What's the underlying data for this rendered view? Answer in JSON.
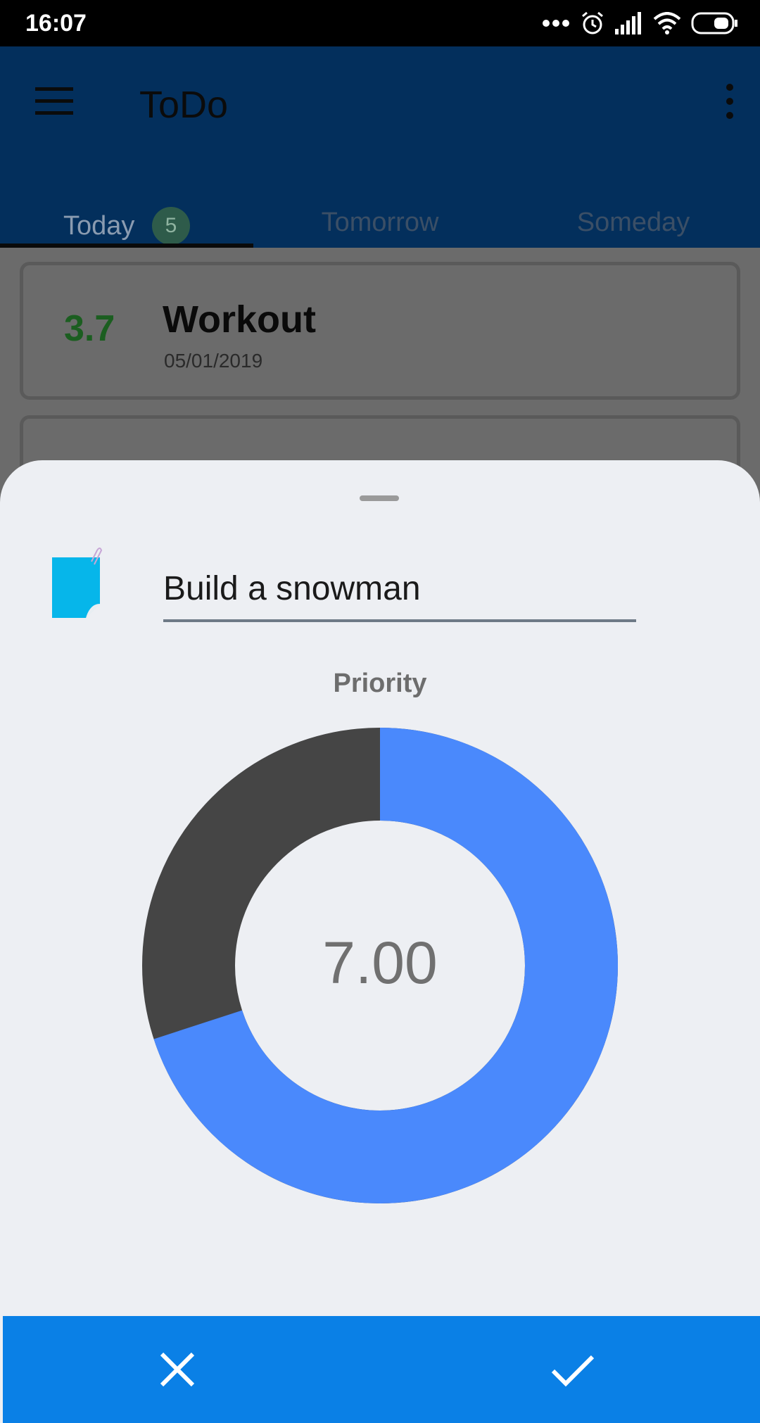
{
  "status_bar": {
    "time": "16:07",
    "icons": [
      "more-dots-icon",
      "alarm-icon",
      "signal-icon",
      "wifi-icon",
      "battery-icon"
    ]
  },
  "app_bar": {
    "title": "ToDo",
    "menu_icon": "hamburger-menu-icon",
    "overflow_icon": "more-vert-icon"
  },
  "tabs": [
    {
      "label": "Today",
      "badge": "5",
      "active": true
    },
    {
      "label": "Tomorrow",
      "active": false
    },
    {
      "label": "Someday",
      "active": false
    }
  ],
  "tasks": [
    {
      "score": "3.7",
      "title": "Workout",
      "date": "05/01/2019"
    }
  ],
  "sheet": {
    "task_name": "Build a snowman",
    "note_icon": "sticky-note-icon",
    "priority_label": "Priority",
    "priority_value": "7.00",
    "priority_fraction": 0.7,
    "actions": {
      "cancel_icon": "close-icon",
      "confirm_icon": "check-icon"
    }
  },
  "colors": {
    "app_bar": "#032f5c",
    "donut_fill": "#4a89fc",
    "donut_remainder": "#454545",
    "action_bar": "#0a80e6",
    "score_green": "#1b5e20"
  }
}
